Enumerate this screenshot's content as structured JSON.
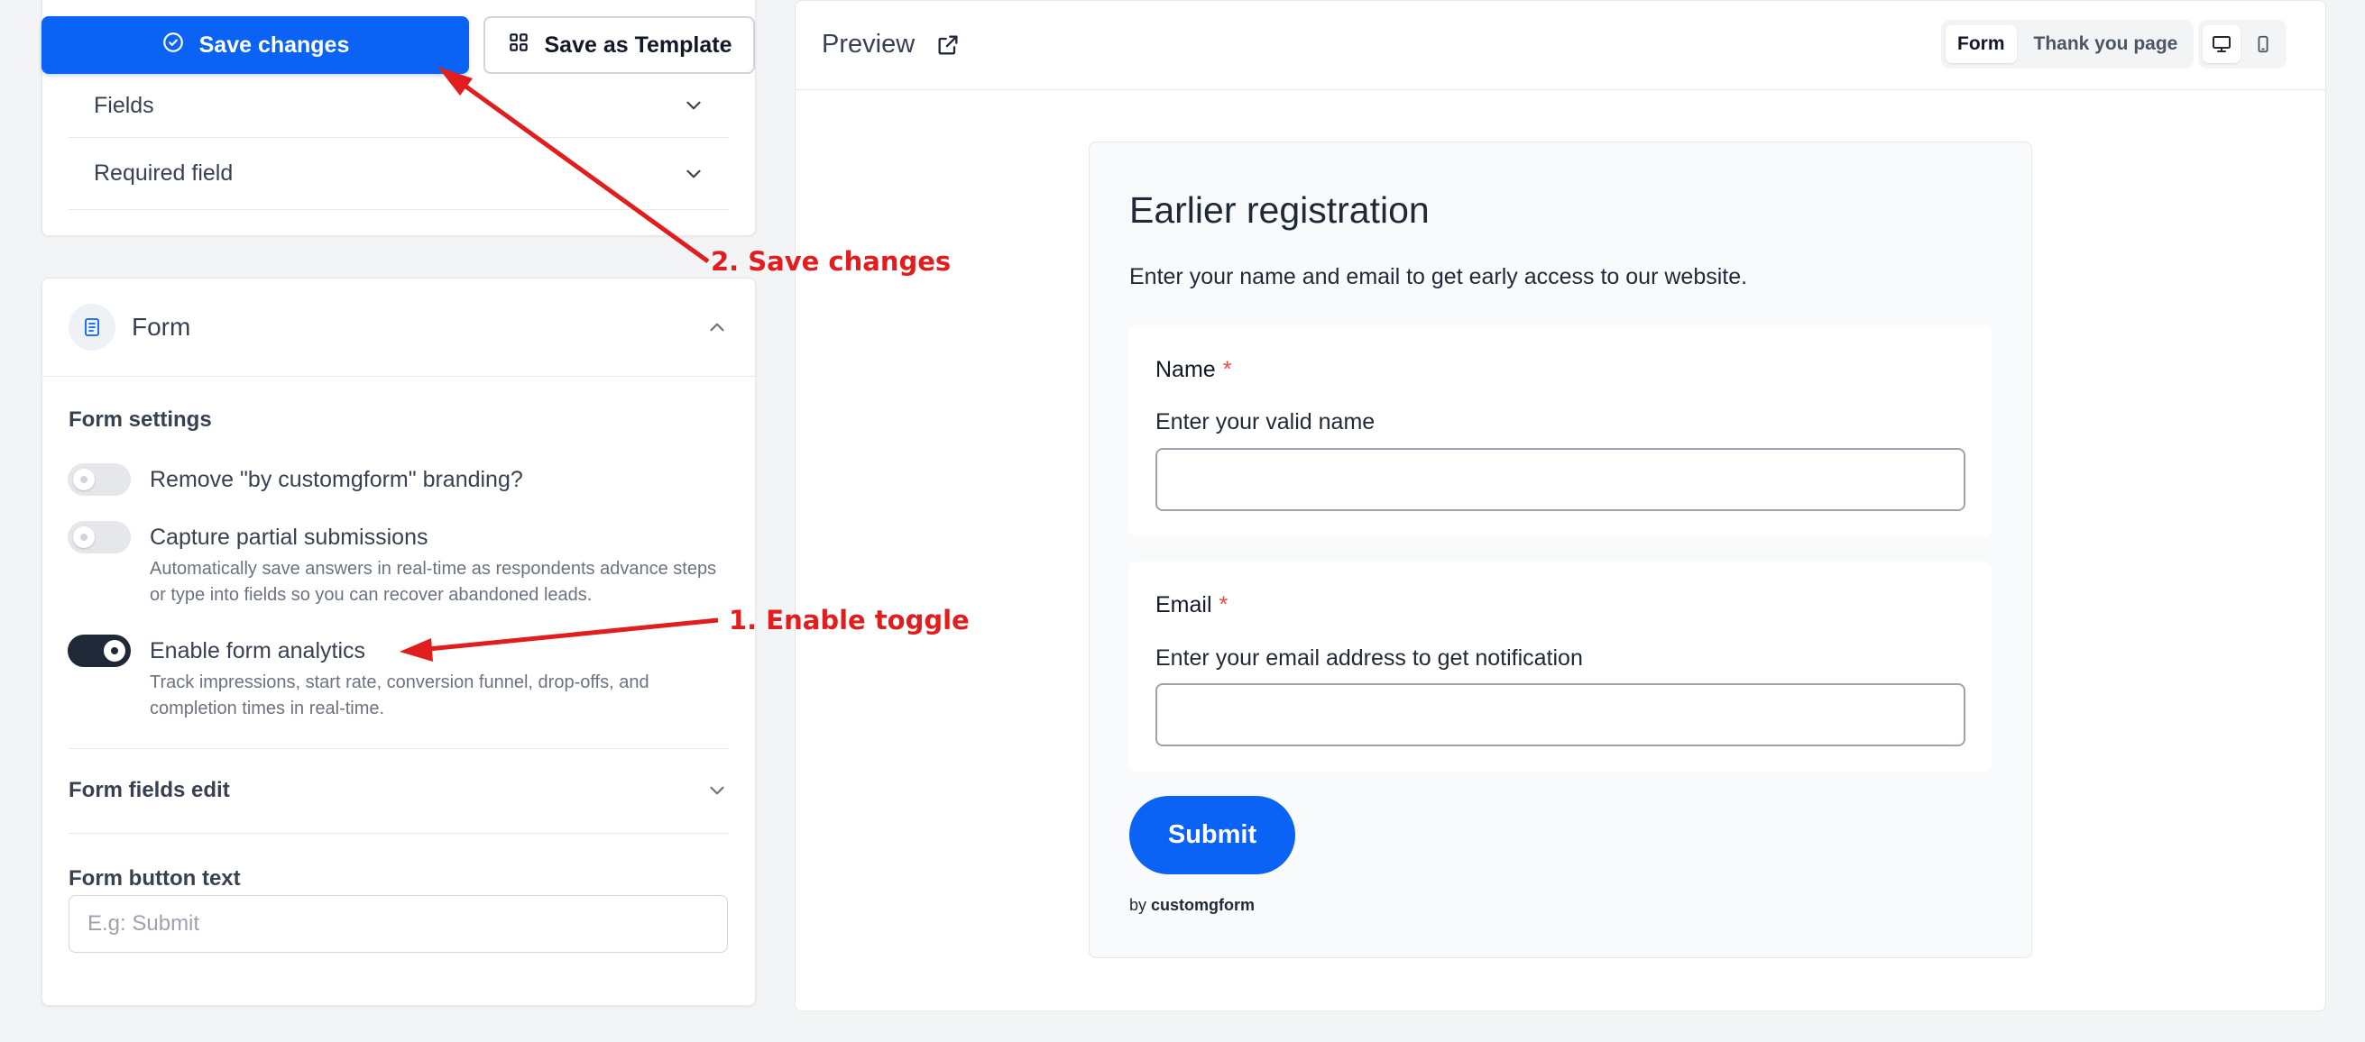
{
  "toolbar": {
    "save_label": "Save changes",
    "template_label": "Save as Template"
  },
  "settings_top": {
    "rows": [
      {
        "label": "Fields"
      },
      {
        "label": "Required field"
      }
    ]
  },
  "form_section": {
    "title": "Form",
    "settings_heading": "Form settings",
    "options": [
      {
        "label": "Remove \"by customgform\" branding?",
        "description": "",
        "enabled": false
      },
      {
        "label": "Capture partial submissions",
        "description": "Automatically save answers in real-time as respondents advance steps or type into fields so you can recover abandoned leads.",
        "enabled": false
      },
      {
        "label": "Enable form analytics",
        "description": "Track impressions, start rate, conversion funnel, drop-offs, and completion times in real-time.",
        "enabled": true
      }
    ],
    "fields_edit_label": "Form fields edit",
    "button_text_label": "Form button text",
    "button_text_placeholder": "E.g: Submit",
    "button_text_value": ""
  },
  "preview": {
    "title": "Preview",
    "tabs": [
      {
        "label": "Form",
        "active": true
      },
      {
        "label": "Thank you page",
        "active": false
      }
    ],
    "devices": [
      {
        "icon": "desktop-icon",
        "active": true
      },
      {
        "icon": "mobile-icon",
        "active": false
      }
    ],
    "form": {
      "title": "Earlier registration",
      "description": "Enter your name and email to get early access to our website.",
      "fields": [
        {
          "label": "Name",
          "required_mark": "*",
          "help": "Enter your valid name",
          "value": ""
        },
        {
          "label": "Email",
          "required_mark": "*",
          "help": "Enter your email address to get notification",
          "value": ""
        }
      ],
      "submit_label": "Submit",
      "branding_prefix": "by",
      "branding_name": "customgform"
    }
  },
  "annotations": {
    "step1": "1. Enable toggle",
    "step2": "2. Save changes"
  },
  "colors": {
    "accent": "#0b63f6",
    "annotation": "#e11d1d",
    "toggle_on": "#1f2937",
    "required": "#ef4444"
  }
}
